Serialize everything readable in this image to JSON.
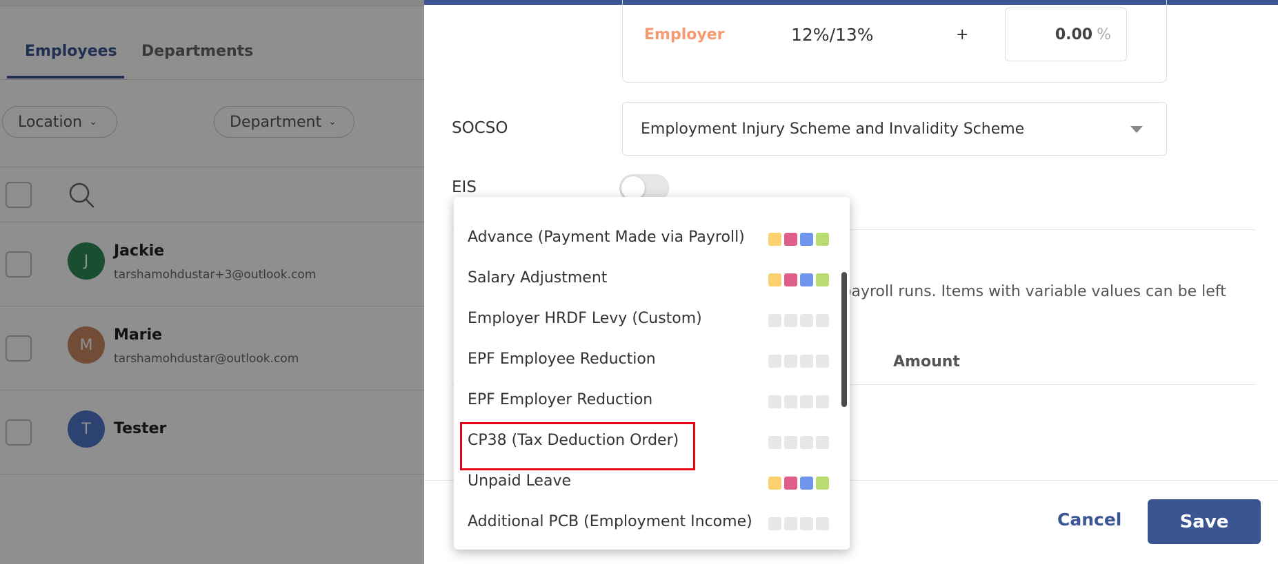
{
  "left": {
    "tabs": [
      {
        "label": "Employees",
        "active": true
      },
      {
        "label": "Departments",
        "active": false
      }
    ],
    "filters": {
      "location_label": "Location",
      "department_label": "Department"
    },
    "employees": [
      {
        "initial": "J",
        "name": "Jackie",
        "email": "tarshamohdustar+3@outlook.com",
        "avatar_color": "#2e8b57"
      },
      {
        "initial": "M",
        "name": "Marie",
        "email": "tarshamohdustar@outlook.com",
        "avatar_color": "#c98a63"
      },
      {
        "initial": "T",
        "name": "Tester",
        "email": "",
        "avatar_color": "#4f78c9"
      }
    ]
  },
  "panel": {
    "accent_color": "#3a5592",
    "epf": {
      "employer_label": "Employer",
      "rate": "12%/13%",
      "plus": "+",
      "additional_value": "0.00",
      "unit": "%"
    },
    "socso": {
      "label": "SOCSO",
      "value": "Employment Injury Scheme and Invalidity Scheme"
    },
    "eis": {
      "label": "EIS",
      "enabled": false
    },
    "description_partial": "s in payroll runs. Items with variable values can be left",
    "columns": {
      "partial": "ts",
      "amount": "Amount"
    },
    "footer": {
      "cancel_label": "Cancel",
      "save_label": "Save"
    }
  },
  "dropdown": {
    "items": [
      {
        "label": "Advance (Payment Made via Payroll)",
        "colored": true,
        "highlighted": false
      },
      {
        "label": "Salary Adjustment",
        "colored": true,
        "highlighted": false
      },
      {
        "label": "Employer HRDF Levy (Custom)",
        "colored": false,
        "highlighted": false
      },
      {
        "label": "EPF Employee Reduction",
        "colored": false,
        "highlighted": false
      },
      {
        "label": "EPF Employer Reduction",
        "colored": false,
        "highlighted": false
      },
      {
        "label": "CP38 (Tax Deduction Order)",
        "colored": false,
        "highlighted": true
      },
      {
        "label": "Unpaid Leave",
        "colored": true,
        "highlighted": false
      },
      {
        "label": "Additional PCB (Employment Income)",
        "colored": false,
        "highlighted": false
      }
    ],
    "chip_colors": [
      "#fcd270",
      "#df5f8a",
      "#6f96ec",
      "#b8dc6f"
    ],
    "highlight_color": "#e30613"
  }
}
